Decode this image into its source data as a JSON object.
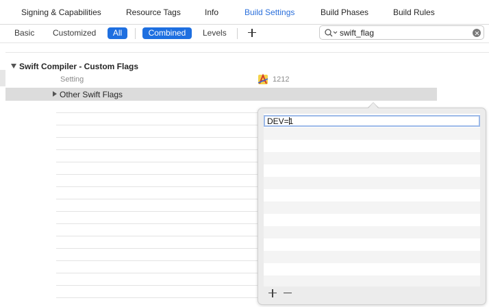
{
  "tabs": [
    {
      "label": "Signing & Capabilities",
      "active": false
    },
    {
      "label": "Resource Tags",
      "active": false
    },
    {
      "label": "Info",
      "active": false
    },
    {
      "label": "Build Settings",
      "active": true
    },
    {
      "label": "Build Phases",
      "active": false
    },
    {
      "label": "Build Rules",
      "active": false
    }
  ],
  "filters": {
    "basic": "Basic",
    "customized": "Customized",
    "all": "All",
    "combined": "Combined",
    "levels": "Levels"
  },
  "search": {
    "value": "swift_flag",
    "icon": "search-icon"
  },
  "section": {
    "title": "Swift Compiler - Custom Flags",
    "column_setting": "Setting",
    "column_target": "1212",
    "target_icon": "app-target-icon"
  },
  "row": {
    "label": "Other Swift Flags"
  },
  "popover": {
    "input_value": "DEV=1"
  },
  "colors": {
    "accent": "#1e6fe0",
    "active_tab": "#2a6fdb"
  }
}
